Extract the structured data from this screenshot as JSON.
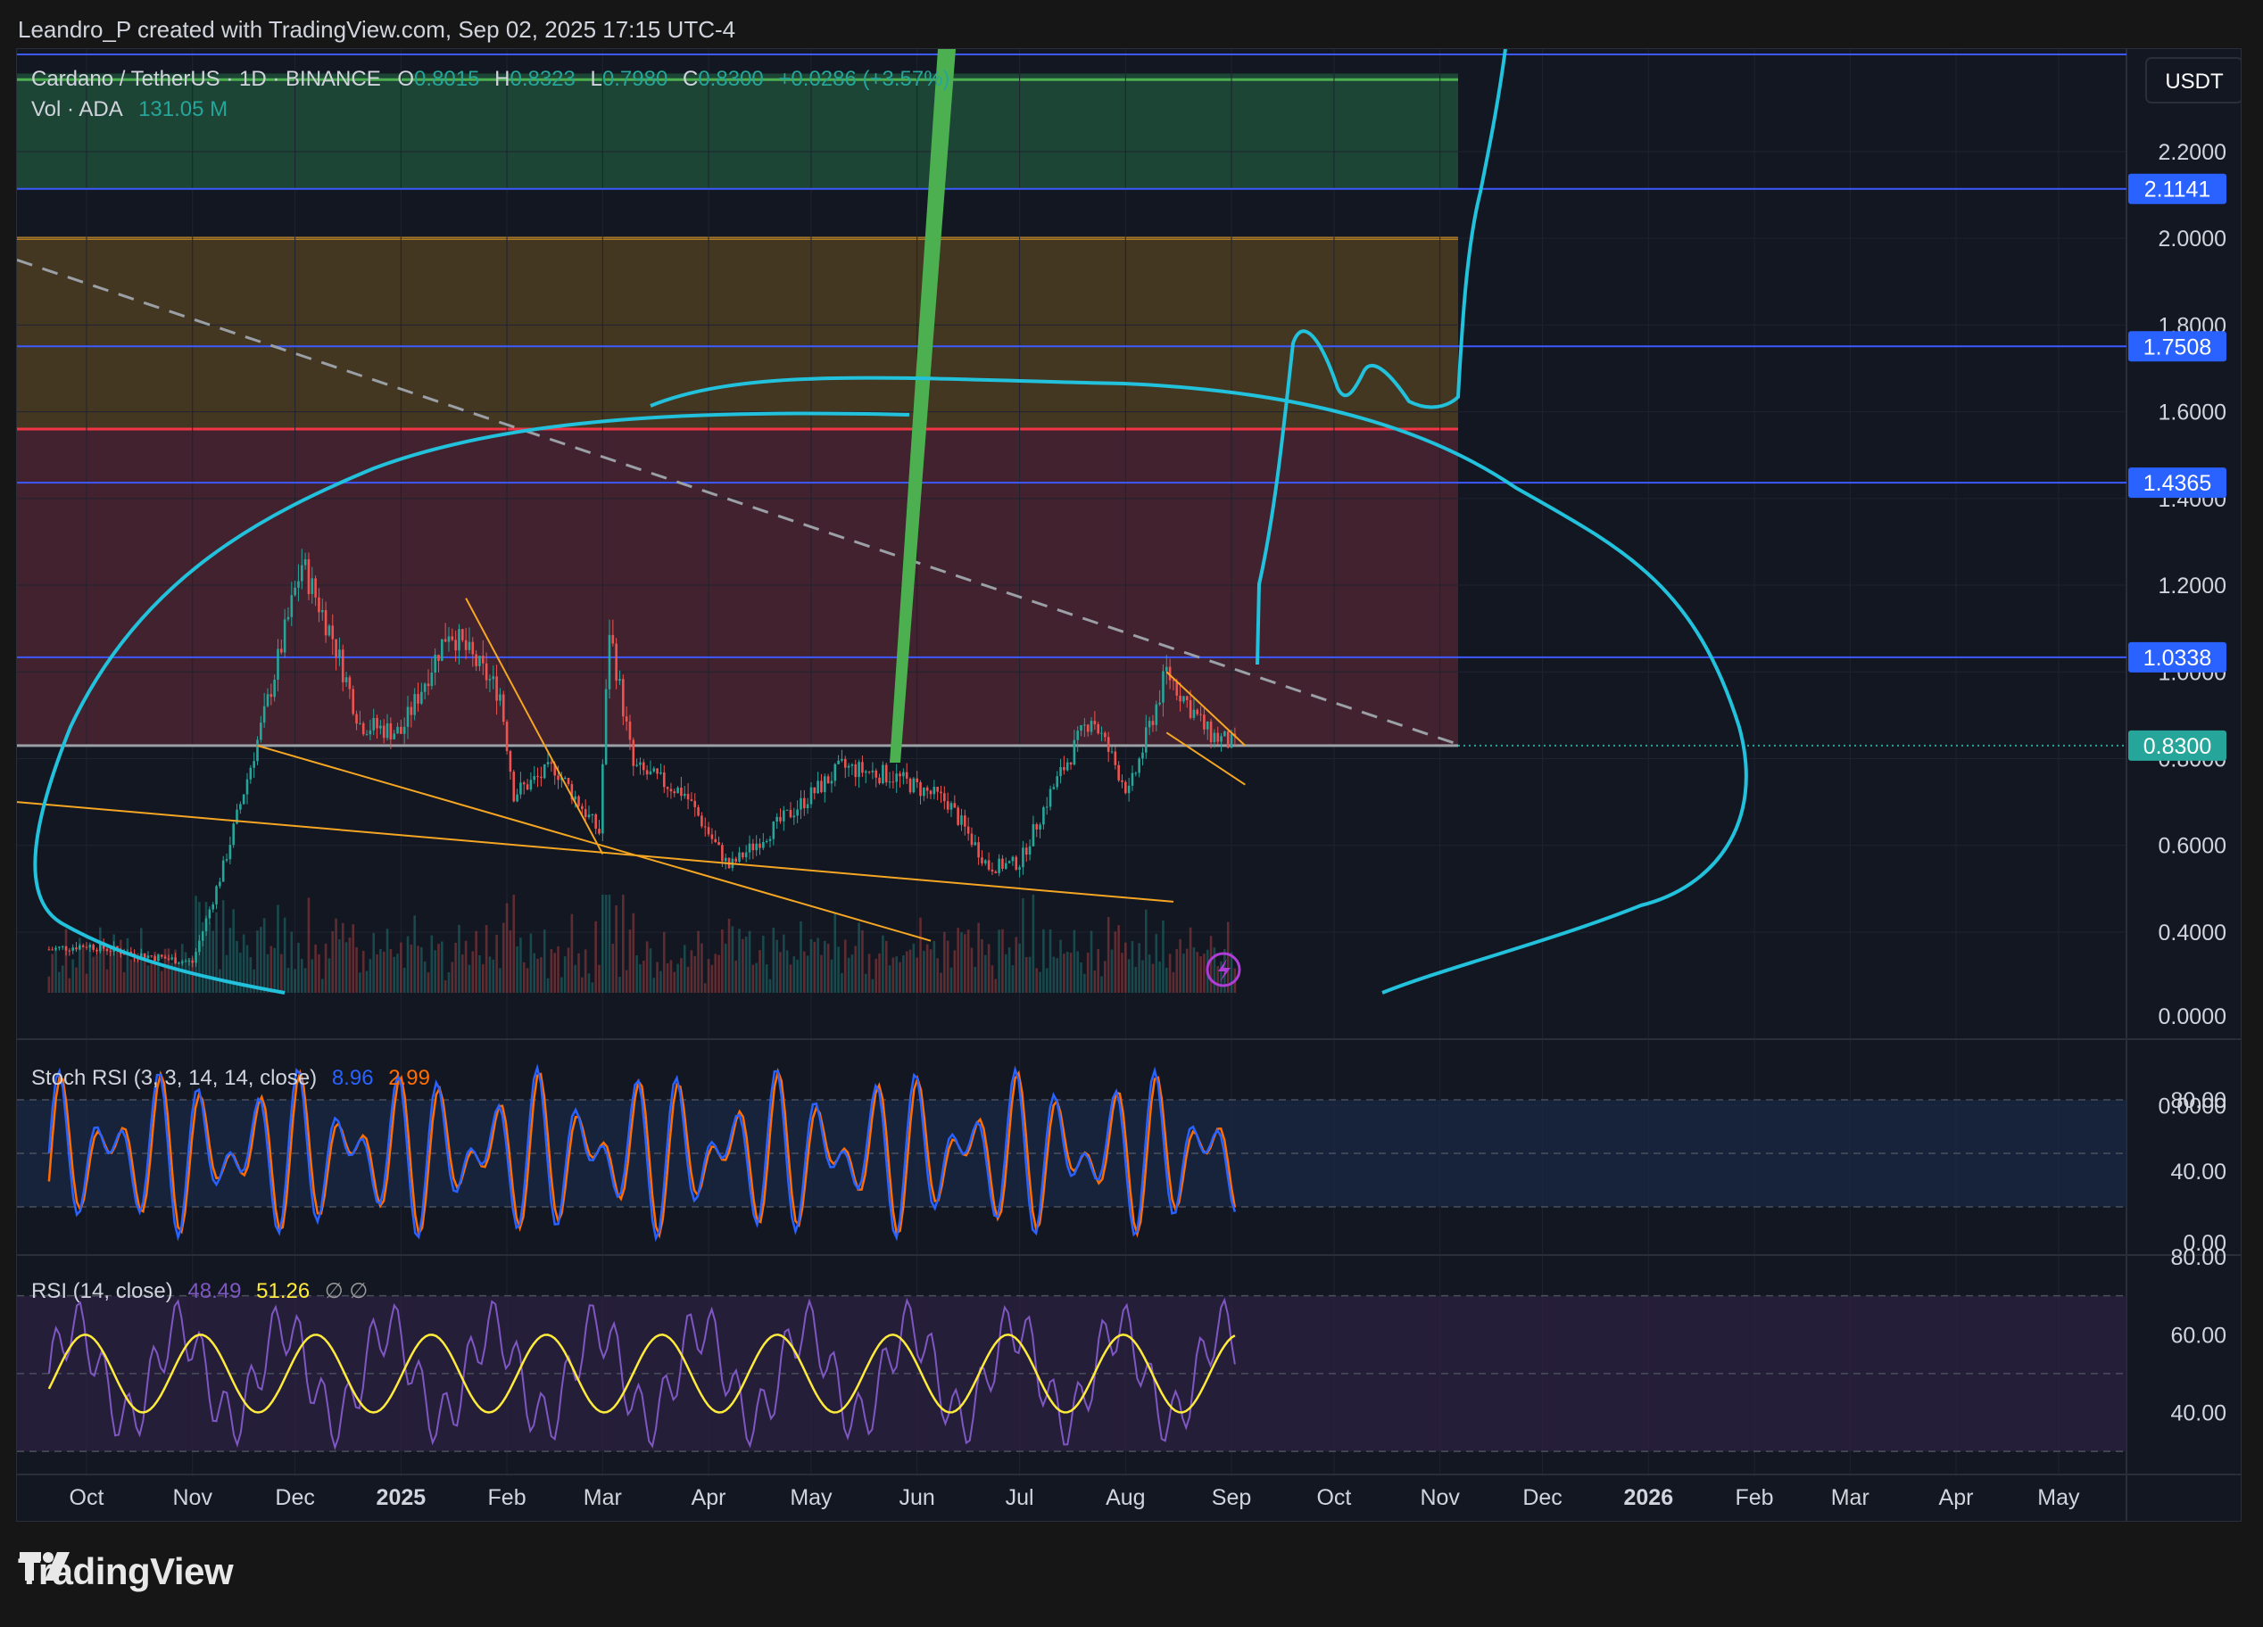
{
  "header": {
    "caption": "Leandro_P created with TradingView.com, Sep 02, 2025 17:15 UTC-4"
  },
  "legend": {
    "symbol": "Cardano / TetherUS · 1D · BINANCE",
    "o_label": "O",
    "o_value": "0.8015",
    "h_label": "H",
    "h_value": "0.8323",
    "l_label": "L",
    "l_value": "0.7980",
    "c_label": "C",
    "c_value": "0.8300",
    "change": "+0.0286 (+3.57%)",
    "vol_label": "Vol · ADA",
    "vol_value": "131.05 M"
  },
  "colors": {
    "up": "#26a69a",
    "down": "#ef5350",
    "accent_blue": "#2962ff",
    "price_badge": "#26a69a",
    "curve": "#22c1dc",
    "arrow": "#4caf50",
    "trend": "#f5a623"
  },
  "chart_data": [
    {
      "type": "candlestick",
      "title": "Cardano / TetherUS · 1D · BINANCE",
      "y_axis_unit": "USDT",
      "y_ticks": [
        "2.2000",
        "2.0000",
        "1.8000",
        "1.6000",
        "1.4000",
        "1.2000",
        "1.0000",
        "0.8000",
        "0.6000",
        "0.4000",
        "0.0000"
      ],
      "x_ticks": [
        "Oct",
        "Nov",
        "Dec",
        "2025",
        "Feb",
        "Mar",
        "Apr",
        "May",
        "Jun",
        "Jul",
        "Aug",
        "Sep",
        "Oct",
        "Nov",
        "Dec",
        "2026",
        "Feb",
        "Mar",
        "Apr",
        "May"
      ],
      "ylim": [
        0.26,
        2.42
      ],
      "horizontal_levels": [
        "2.1141",
        "1.7508",
        "1.4365",
        "1.0338"
      ],
      "last_price": "0.8300",
      "zones": [
        {
          "name": "green zone",
          "from": 2.1141,
          "to": 2.38,
          "color": "#1e4d3a"
        },
        {
          "name": "orange zone",
          "from": 1.56,
          "to": 2.0,
          "color": "#4e3d22"
        },
        {
          "name": "red zone",
          "from": 0.83,
          "to": 1.56,
          "color": "#4a2430"
        }
      ],
      "price_path": [
        [
          "2024-09-20",
          0.36
        ],
        [
          "2024-10-01",
          0.37
        ],
        [
          "2024-10-15",
          0.35
        ],
        [
          "2024-11-01",
          0.33
        ],
        [
          "2024-11-10",
          0.55
        ],
        [
          "2024-11-22",
          0.9
        ],
        [
          "2024-12-03",
          1.25
        ],
        [
          "2024-12-12",
          1.08
        ],
        [
          "2024-12-20",
          0.88
        ],
        [
          "2025-01-01",
          0.86
        ],
        [
          "2025-01-15",
          1.1
        ],
        [
          "2025-01-30",
          0.95
        ],
        [
          "2025-02-03",
          0.72
        ],
        [
          "2025-02-15",
          0.78
        ],
        [
          "2025-02-28",
          0.63
        ],
        [
          "2025-03-03",
          1.1
        ],
        [
          "2025-03-10",
          0.78
        ],
        [
          "2025-03-25",
          0.72
        ],
        [
          "2025-04-07",
          0.55
        ],
        [
          "2025-04-20",
          0.64
        ],
        [
          "2025-05-10",
          0.78
        ],
        [
          "2025-05-25",
          0.76
        ],
        [
          "2025-06-10",
          0.7
        ],
        [
          "2025-06-22",
          0.55
        ],
        [
          "2025-07-01",
          0.56
        ],
        [
          "2025-07-10",
          0.72
        ],
        [
          "2025-07-22",
          0.9
        ],
        [
          "2025-08-02",
          0.72
        ],
        [
          "2025-08-13",
          1.0
        ],
        [
          "2025-08-25",
          0.86
        ],
        [
          "2025-09-02",
          0.83
        ]
      ],
      "volume_label": "Vol · ADA",
      "volume_last": "131.05 M"
    },
    {
      "type": "line",
      "title": "Stoch RSI (3, 3, 14, 14, close)",
      "series": [
        {
          "name": "K",
          "last": "8.96",
          "color": "#2962ff"
        },
        {
          "name": "D",
          "last": "2.99",
          "color": "#ff6d00"
        }
      ],
      "y_ticks": [
        "80.00",
        "40.00",
        "0.00"
      ],
      "ylim": [
        -5,
        105
      ]
    },
    {
      "type": "line",
      "title": "RSI (14, close)",
      "series": [
        {
          "name": "RSI",
          "last": "48.49",
          "color": "#7e57c2"
        },
        {
          "name": "MA",
          "last": "51.26",
          "color": "#ffeb3b"
        }
      ],
      "y_ticks": [
        "80.00",
        "60.00",
        "40.00"
      ],
      "ylim": [
        25,
        80
      ]
    }
  ],
  "axis": {
    "unit_label": "USDT"
  },
  "stoch_legend": {
    "label": "Stoch RSI (3, 3, 14, 14, close)",
    "k": "8.96",
    "d": "2.99"
  },
  "rsi_legend": {
    "label": "RSI (14, close)",
    "rsi": "48.49",
    "ma": "51.26",
    "extra": "∅ ∅"
  },
  "branding": {
    "logo_text": "TradingView"
  }
}
